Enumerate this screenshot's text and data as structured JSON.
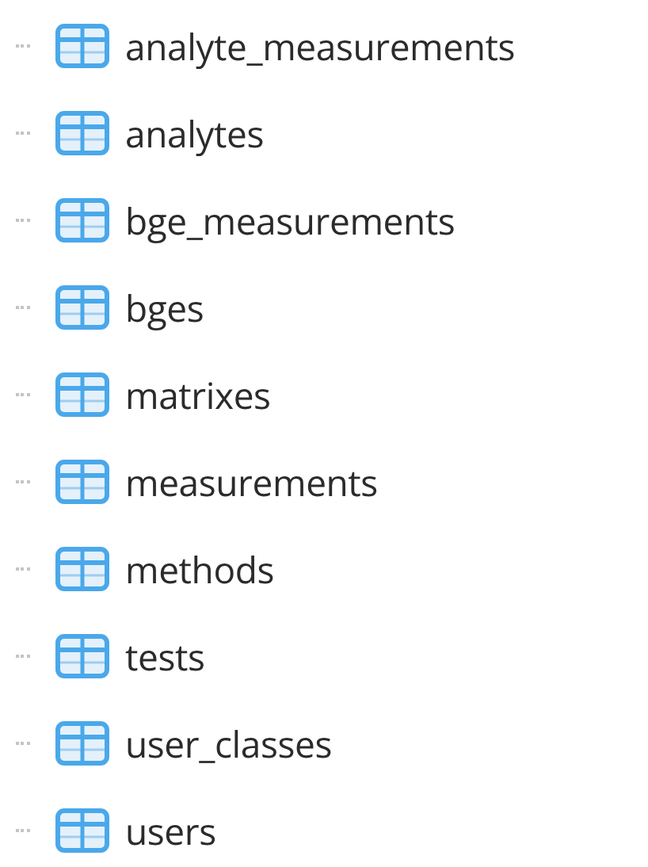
{
  "tables": [
    {
      "name": "analyte_measurements"
    },
    {
      "name": "analytes"
    },
    {
      "name": "bge_measurements"
    },
    {
      "name": "bges"
    },
    {
      "name": "matrixes"
    },
    {
      "name": "measurements"
    },
    {
      "name": "methods"
    },
    {
      "name": "tests"
    },
    {
      "name": "user_classes"
    },
    {
      "name": "users"
    }
  ]
}
